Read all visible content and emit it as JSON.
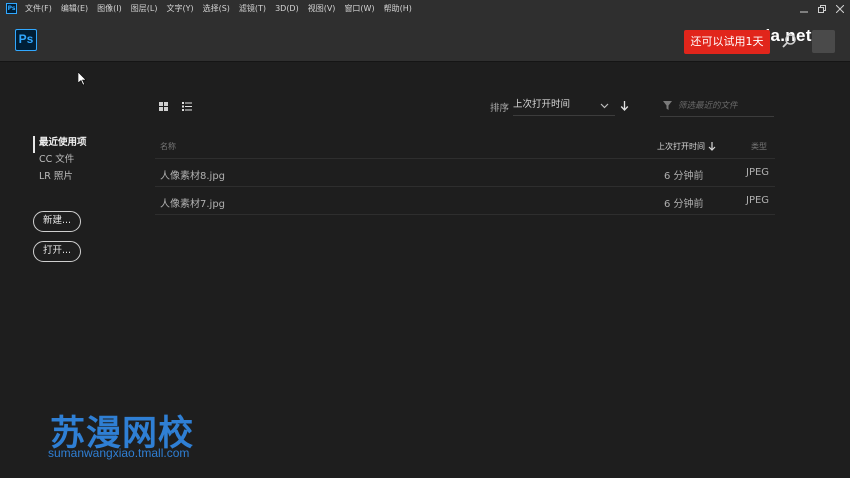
{
  "menubar": {
    "app_icon": "Ps",
    "items": [
      "文件(F)",
      "编辑(E)",
      "图像(I)",
      "图层(L)",
      "文字(Y)",
      "选择(S)",
      "滤镜(T)",
      "3D(D)",
      "视图(V)",
      "窗口(W)",
      "帮助(H)"
    ]
  },
  "header": {
    "logo": "Ps",
    "trial_button": "还可以试用1天",
    "search_icon": "search-icon",
    "watermark": "vxia.net"
  },
  "sidebar": {
    "items": [
      "最近使用项",
      "CC 文件",
      "LR 照片"
    ],
    "active_index": 0,
    "new_button": "新建...",
    "open_button": "打开..."
  },
  "toolbar": {
    "sort_label": "排序",
    "sort_value": "上次打开时间",
    "filter_placeholder": "筛选最近的文件"
  },
  "table": {
    "headers": {
      "name": "名称",
      "time": "上次打开时间",
      "type": "类型"
    },
    "rows": [
      {
        "name": "人像素材8.jpg",
        "time": "6 分钟前",
        "type": "JPEG"
      },
      {
        "name": "人像素材7.jpg",
        "time": "6 分钟前",
        "type": "JPEG"
      }
    ]
  },
  "watermark": {
    "title": "苏漫网校",
    "url": "sumanwangxiao.tmall.com"
  },
  "colors": {
    "accent": "#31a8ff",
    "trial": "#e1251b",
    "watermark": "#2f7fd4",
    "background": "#1e1e1e"
  }
}
